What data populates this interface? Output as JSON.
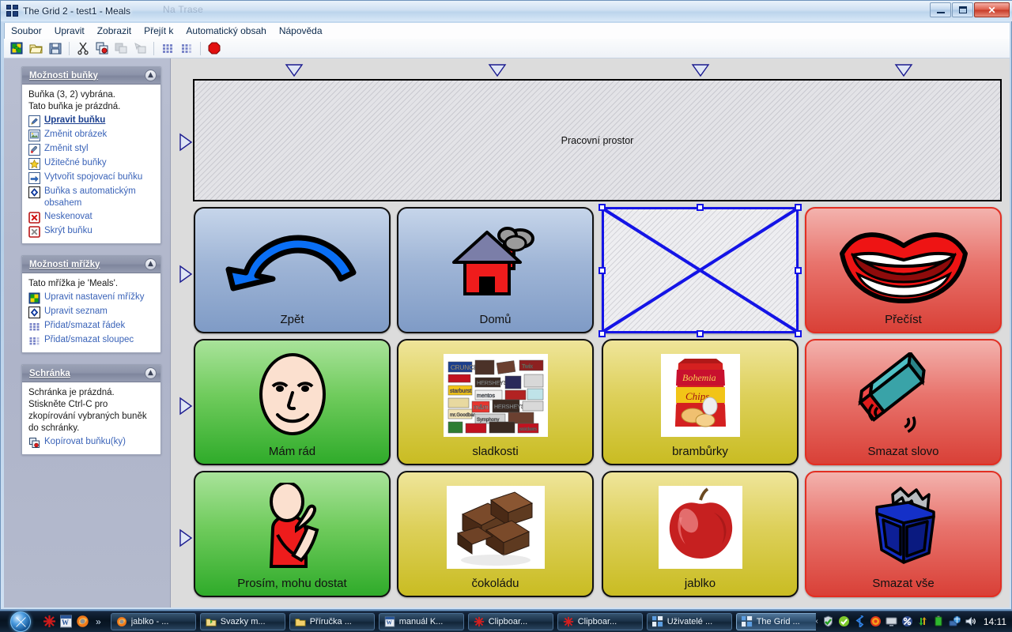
{
  "window": {
    "title": "The Grid 2 - test1 - Meals",
    "app_icon": "grid-logo-icon",
    "ghost_title": "Na Trase",
    "minimize_label": "Minimalizovat",
    "maximize_label": "Maximalizovat",
    "close_label": "Zavřít"
  },
  "menubar": {
    "items": [
      {
        "label": "Soubor",
        "name": "menu-soubor"
      },
      {
        "label": "Upravit",
        "name": "menu-upravit"
      },
      {
        "label": "Zobrazit",
        "name": "menu-zobrazit"
      },
      {
        "label": "Přejít k",
        "name": "menu-prejit-k"
      },
      {
        "label": "Automatický obsah",
        "name": "menu-automaticky-obsah"
      },
      {
        "label": "Nápověda",
        "name": "menu-napoveda"
      }
    ]
  },
  "toolbar": {
    "buttons": [
      {
        "name": "new-grid-button",
        "icon": "new-grid-icon",
        "label": "Nová mřížka",
        "enabled": true
      },
      {
        "name": "open-button",
        "icon": "open-folder-icon",
        "label": "Otevřít",
        "enabled": true
      },
      {
        "name": "save-button",
        "icon": "floppy-save-icon",
        "label": "Uložit",
        "enabled": true
      },
      {
        "name": "cut-button",
        "icon": "scissors-icon",
        "label": "Vyjmout",
        "enabled": true
      },
      {
        "name": "copy-button",
        "icon": "copy-cells-icon",
        "label": "Kopírovat",
        "enabled": true
      },
      {
        "name": "paste-button",
        "icon": "paste-icon",
        "label": "Vložit",
        "enabled": false
      },
      {
        "name": "paste-special-button",
        "icon": "paste-special-icon",
        "label": "Vložit jinak",
        "enabled": false
      },
      {
        "name": "add-row-button",
        "icon": "grid-rows-icon",
        "label": "Přidat/smazat řádek",
        "enabled": true
      },
      {
        "name": "add-column-button",
        "icon": "grid-columns-icon",
        "label": "Přidat/smazat sloupec",
        "enabled": true
      },
      {
        "name": "stop-button",
        "icon": "stop-octagon-icon",
        "label": "Zastavit",
        "enabled": true
      }
    ]
  },
  "sidebar": {
    "panels": [
      {
        "name": "cell-options-panel",
        "title": "Možnosti buňky",
        "collapse_icon": "chevron-up-icon",
        "texts": [
          "Buňka (3, 2) vybrána.",
          "Tato buňka je prázdná."
        ],
        "actions": [
          {
            "label": "Upravit buňku",
            "icon": "pencil-edit-icon",
            "name": "edit-cell-link",
            "bold": true
          },
          {
            "label": "Změnit obrázek",
            "icon": "picture-icon",
            "name": "change-image-link",
            "bold": false
          },
          {
            "label": "Změnit styl",
            "icon": "paint-palette-icon",
            "name": "change-style-link",
            "bold": false
          },
          {
            "label": "Užitečné buňky",
            "icon": "star-icon",
            "name": "useful-cells-link",
            "bold": false
          },
          {
            "label": "Vytvořit spojovací buňku",
            "icon": "arrow-right-icon",
            "name": "create-jump-cell-link",
            "bold": false
          },
          {
            "label": "Buňka s automatickým obsahem",
            "icon": "blue-diamond-icon",
            "name": "auto-content-cell-link",
            "bold": false
          },
          {
            "label": "Neskenovat",
            "icon": "red-x-icon",
            "name": "do-not-scan-link",
            "bold": false
          },
          {
            "label": "Skrýt buňku",
            "icon": "gray-x-icon",
            "name": "hide-cell-link",
            "bold": false
          }
        ]
      },
      {
        "name": "grid-options-panel",
        "title": "Možnosti mřížky",
        "collapse_icon": "chevron-up-icon",
        "texts": [
          "Tato mřížka je 'Meals'."
        ],
        "actions": [
          {
            "label": "Upravit nastavení mřížky",
            "icon": "checkerboard-icon",
            "name": "edit-grid-settings-link",
            "bold": false
          },
          {
            "label": "Upravit seznam",
            "icon": "blue-diamond-icon",
            "name": "edit-list-link",
            "bold": false
          },
          {
            "label": "Přidat/smazat řádek",
            "icon": "grid-rows-icon",
            "name": "add-delete-row-link",
            "bold": false
          },
          {
            "label": "Přidat/smazat sloupec",
            "icon": "grid-columns-icon",
            "name": "add-delete-column-link",
            "bold": false
          }
        ]
      },
      {
        "name": "clipboard-panel",
        "title": "Schránka",
        "collapse_icon": "chevron-up-icon",
        "texts": [
          "Schránka je prázdná.",
          "Stiskněte Ctrl-C pro zkopírování vybraných buněk do schránky."
        ],
        "actions": [
          {
            "label": "Kopírovat buňku(ky)",
            "icon": "copy-cells-icon",
            "name": "copy-cells-link",
            "bold": false
          }
        ]
      }
    ]
  },
  "grid": {
    "workspace_label": "Pracovní prostor",
    "column_markers": 4,
    "row_markers": 4,
    "column_marker_icon": "triangle-down-icon",
    "row_marker_icon": "triangle-right-icon",
    "selection": {
      "cell": "(3, 2)",
      "handles": 8,
      "color": "#1414e6"
    },
    "cells": [
      {
        "name": "cell-zpet",
        "label": "Zpět",
        "color": "blue",
        "icon": "back-arrow-icon",
        "selected": false
      },
      {
        "name": "cell-domu",
        "label": "Domů",
        "color": "blue",
        "icon": "house-icon",
        "selected": false
      },
      {
        "name": "cell-empty",
        "label": "",
        "color": "empty",
        "icon": "empty-cell-icon",
        "selected": true
      },
      {
        "name": "cell-precist",
        "label": "Přečíst",
        "color": "red",
        "icon": "mouth-lips-icon",
        "selected": false
      },
      {
        "name": "cell-mam-rad",
        "label": "Mám rád",
        "color": "green",
        "icon": "smiley-face-icon",
        "selected": false
      },
      {
        "name": "cell-sladkosti",
        "label": "sladkosti",
        "color": "yellow",
        "icon": "candy-photo-icon",
        "selected": false
      },
      {
        "name": "cell-bramburky",
        "label": "brambůrky",
        "color": "yellow",
        "icon": "chips-bag-photo-icon",
        "selected": false
      },
      {
        "name": "cell-smazat-slovo",
        "label": "Smazat slovo",
        "color": "red",
        "icon": "eraser-icon",
        "selected": false
      },
      {
        "name": "cell-prosim",
        "label": "Prosím, mohu dostat",
        "color": "green",
        "icon": "person-asking-icon",
        "selected": false
      },
      {
        "name": "cell-cokoladu",
        "label": "čokoládu",
        "color": "yellow",
        "icon": "chocolate-photo-icon",
        "selected": false
      },
      {
        "name": "cell-jablko",
        "label": "jablko",
        "color": "yellow",
        "icon": "apple-photo-icon",
        "selected": false
      },
      {
        "name": "cell-smazat-vse",
        "label": "Smazat vše",
        "color": "red",
        "icon": "trash-bin-icon",
        "selected": false
      }
    ]
  },
  "taskbar": {
    "start_label": "Start",
    "start_icon": "windows-orb-icon",
    "quick_launch": [
      {
        "name": "ql-clipboard-icon",
        "icon": "red-snowflake-icon"
      },
      {
        "name": "ql-word-icon",
        "icon": "word-document-icon"
      },
      {
        "name": "ql-firefox-icon",
        "icon": "firefox-icon"
      }
    ],
    "quick_launch_overflow": "»",
    "tasks": [
      {
        "name": "task-jablko",
        "label": "jablko - ...",
        "icon": "firefox-icon",
        "active": false
      },
      {
        "name": "task-svazky",
        "label": "Svazky m...",
        "icon": "green-folder-icon",
        "active": false
      },
      {
        "name": "task-prirucka",
        "label": "Příručka ...",
        "icon": "yellow-folder-icon",
        "active": false
      },
      {
        "name": "task-manual",
        "label": "manuál K...",
        "icon": "word-document-icon",
        "active": false
      },
      {
        "name": "task-clipboard-1",
        "label": "Clipboar...",
        "icon": "red-snowflake-icon",
        "active": false
      },
      {
        "name": "task-clipboard-2",
        "label": "Clipboar...",
        "icon": "red-snowflake-icon",
        "active": false
      },
      {
        "name": "task-uzivatele",
        "label": "Uživatelé ...",
        "icon": "grid-logo-icon",
        "active": false
      },
      {
        "name": "task-the-grid",
        "label": "The Grid ...",
        "icon": "grid-logo-icon",
        "active": true
      }
    ],
    "tray_expand": "‹",
    "tray_icons": [
      {
        "name": "tray-antivirus-icon",
        "icon": "shield-check-icon"
      },
      {
        "name": "tray-update-icon",
        "icon": "green-check-icon"
      },
      {
        "name": "tray-bluetooth-icon",
        "icon": "bluetooth-icon"
      },
      {
        "name": "tray-opera-icon",
        "icon": "swirl-icon"
      },
      {
        "name": "tray-display-icon",
        "icon": "monitor-icon"
      },
      {
        "name": "tray-nomachine-icon",
        "icon": "percent-icon"
      },
      {
        "name": "tray-sync-icon",
        "icon": "sync-arrows-icon"
      },
      {
        "name": "tray-battery-icon",
        "icon": "battery-icon"
      },
      {
        "name": "tray-network-icon",
        "icon": "network-globe-icon"
      },
      {
        "name": "tray-volume-icon",
        "icon": "speaker-icon"
      }
    ],
    "clock": "14:11"
  }
}
